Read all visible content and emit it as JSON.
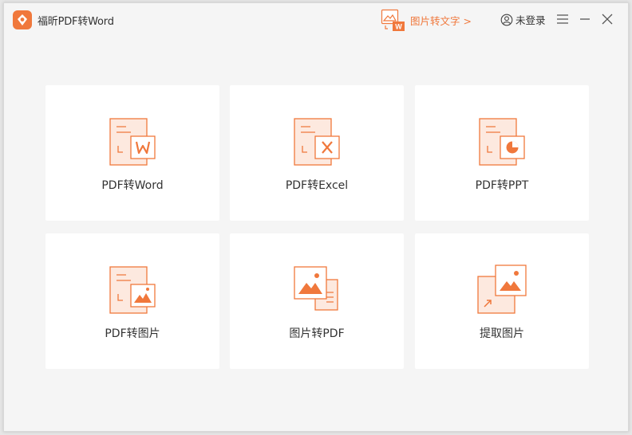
{
  "app": {
    "title": "福昕PDF转Word",
    "accent": "#f0783c"
  },
  "header": {
    "ocr_link": "图片转文字 >",
    "login": "未登录",
    "menu_icon": "hamburger-icon",
    "minimize_icon": "minimize-icon",
    "close_icon": "close-icon"
  },
  "tools": [
    {
      "label": "PDF转Word",
      "icon": "pdf-to-word-icon"
    },
    {
      "label": "PDF转Excel",
      "icon": "pdf-to-excel-icon"
    },
    {
      "label": "PDF转PPT",
      "icon": "pdf-to-ppt-icon"
    },
    {
      "label": "PDF转图片",
      "icon": "pdf-to-image-icon"
    },
    {
      "label": "图片转PDF",
      "icon": "image-to-pdf-icon"
    },
    {
      "label": "提取图片",
      "icon": "extract-image-icon"
    }
  ]
}
